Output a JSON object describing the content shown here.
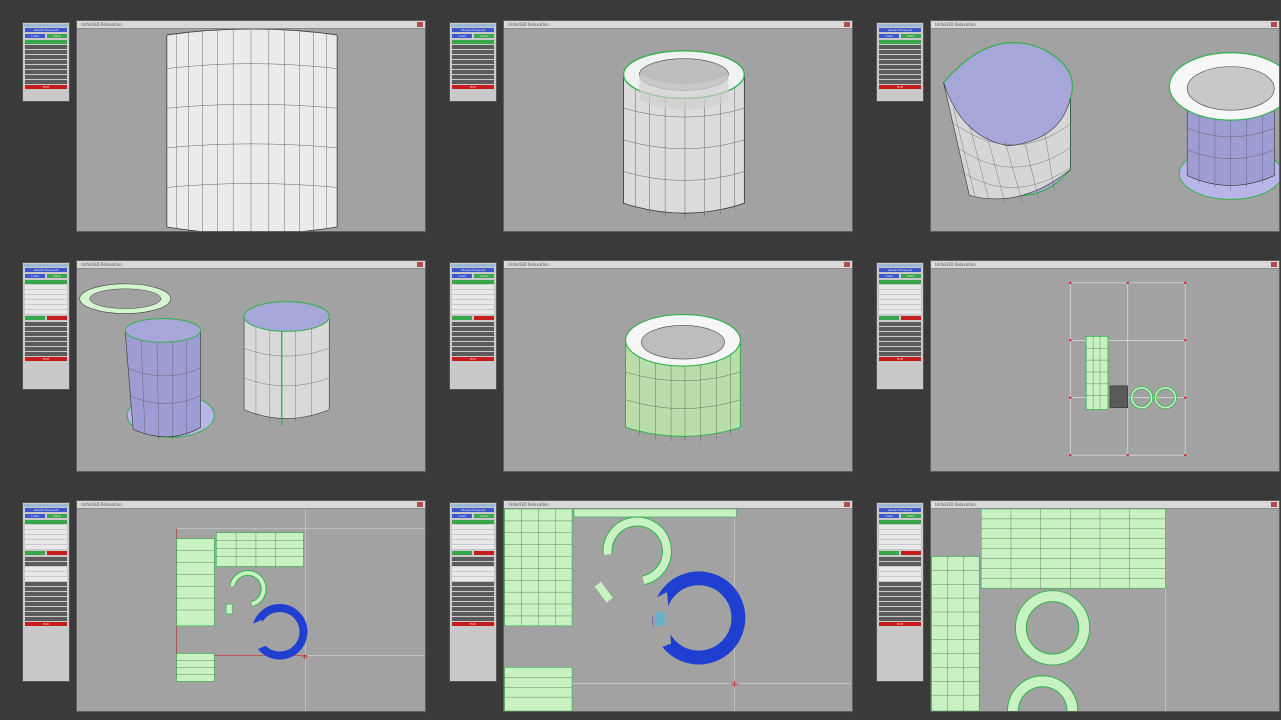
{
  "window_title": "Unfold3D Relaxation",
  "toolbox": {
    "about_label": "About UVLayout",
    "load_label": "Load",
    "save_label": "Save",
    "exit_label": "Exit"
  },
  "colors": {
    "background": "#3a3a3a",
    "viewport": "#a2a2a2",
    "mesh_light": "#e9e9e9",
    "mesh_blue": "#a7a6d9",
    "selection_green": "#c9f2c2",
    "seam_green": "#2fb44a",
    "flatten_blue": "#1f3fd1",
    "cut_red": "#c21b1b"
  },
  "panels": [
    {
      "name": "cylinder-closeup"
    },
    {
      "name": "cylinder-with-rim"
    },
    {
      "name": "split-shells"
    },
    {
      "name": "exploded-shells"
    },
    {
      "name": "selected-shell"
    },
    {
      "name": "uv-grid-layout"
    },
    {
      "name": "uv-flattening"
    },
    {
      "name": "uv-zoom-detail"
    },
    {
      "name": "uv-packed-result"
    }
  ]
}
